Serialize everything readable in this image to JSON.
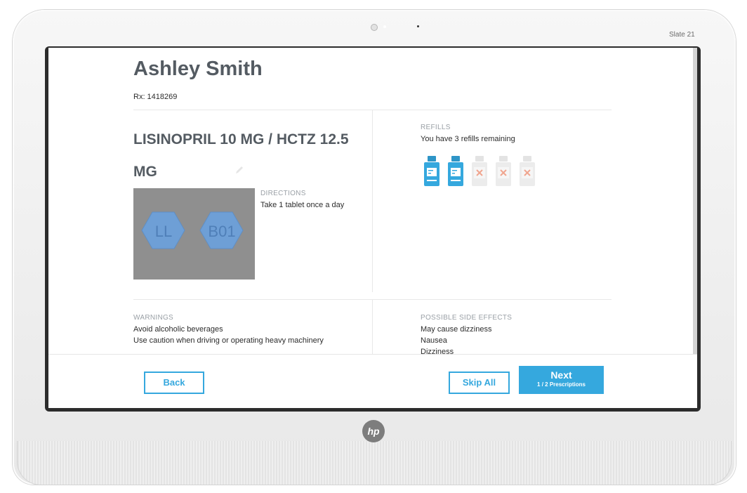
{
  "device": {
    "model_label": "Slate 21",
    "logo_text": "hp"
  },
  "patient": {
    "name": "Ashley Smith",
    "rx": "Rx: 1418269"
  },
  "medication": {
    "name": "LISINOPRIL 10 MG / HCTZ 12.5 MG",
    "pill_imprints": [
      "LL",
      "B01"
    ]
  },
  "directions": {
    "label": "DIRECTIONS",
    "text": "Take 1 tablet once a day"
  },
  "refills": {
    "label": "REFILLS",
    "text": "You have 3 refills remaining",
    "bottles": [
      {
        "state": "available"
      },
      {
        "state": "available"
      },
      {
        "state": "used"
      },
      {
        "state": "used"
      },
      {
        "state": "used"
      }
    ]
  },
  "warnings": {
    "label": "WARNINGS",
    "items": [
      "Avoid alcoholic beverages",
      "Use caution when driving or operating heavy machinery"
    ]
  },
  "side_effects": {
    "label": "POSSIBLE SIDE EFFECTS",
    "items": [
      "May cause dizziness",
      "Nausea",
      "Dizziness"
    ]
  },
  "footer": {
    "back_label": "Back",
    "skip_label": "Skip All",
    "next_label": "Next",
    "next_sub": "1 / 2 Prescriptions"
  },
  "colors": {
    "accent": "#35a8de",
    "heading": "#545b62",
    "muted": "#9aa0a6"
  }
}
